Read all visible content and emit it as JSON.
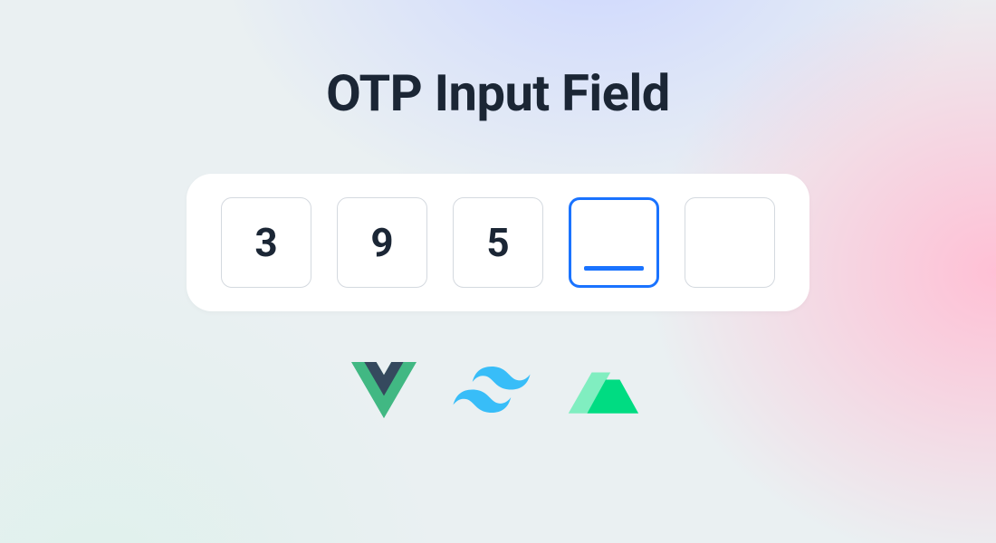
{
  "title": "OTP Input Field",
  "otp": {
    "cells": [
      {
        "value": "3",
        "active": false
      },
      {
        "value": "9",
        "active": false
      },
      {
        "value": "5",
        "active": false
      },
      {
        "value": "",
        "active": true
      },
      {
        "value": "",
        "active": false
      }
    ],
    "accent_color": "#1a73ff",
    "text_color": "#1b2635"
  },
  "logos": [
    {
      "name": "vue-icon"
    },
    {
      "name": "tailwind-icon"
    },
    {
      "name": "nuxt-icon"
    }
  ]
}
